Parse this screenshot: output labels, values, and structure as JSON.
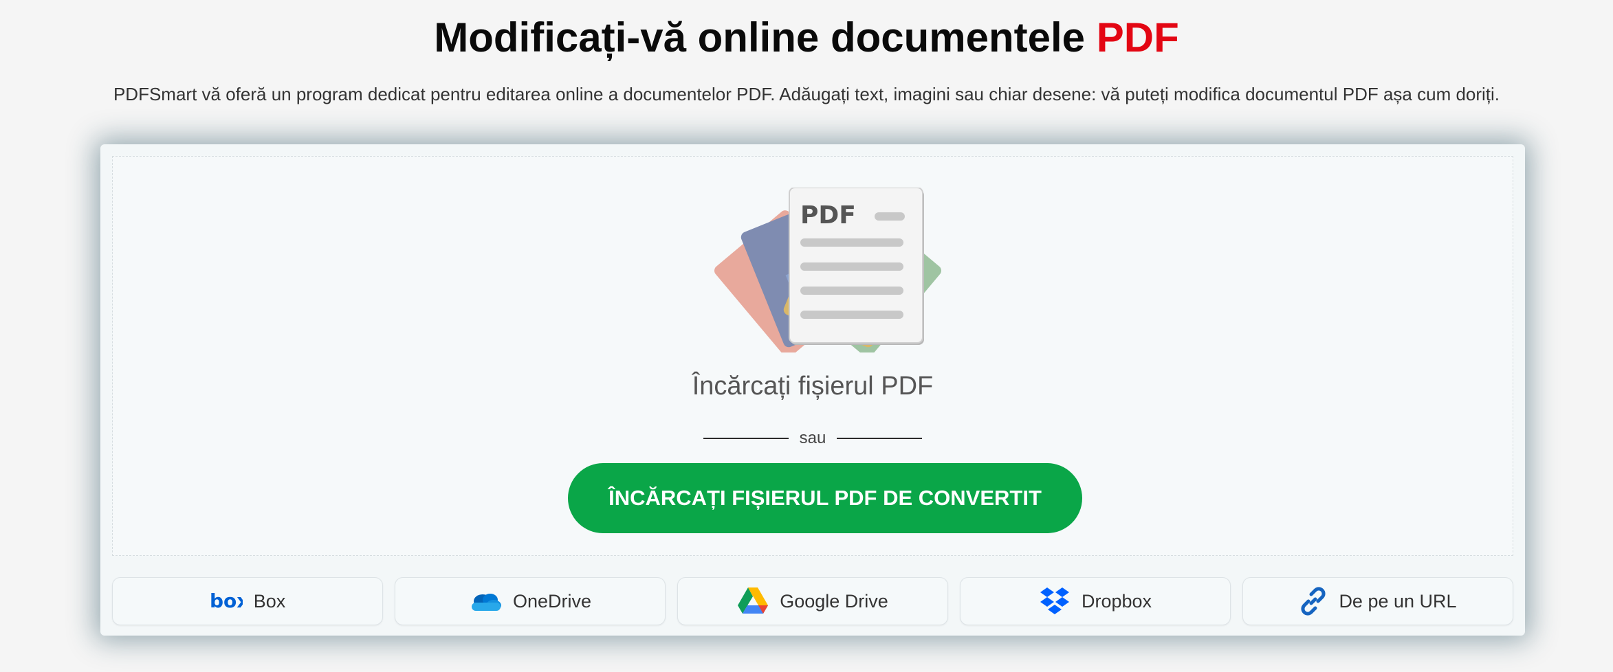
{
  "header": {
    "title_main": "Modificați-vă online documentele",
    "title_accent": "PDF",
    "subtitle": "PDFSmart vă oferă un program dedicat pentru editarea online a documentelor PDF. Adăugați text, imagini sau chiar desene: vă puteți modifica documentul PDF așa cum doriți."
  },
  "dropzone": {
    "illustration_icon": "pdf-document-stack-icon",
    "doc_label": "PDF",
    "upload_label": "Încărcați fișierul PDF",
    "or_text": "sau",
    "upload_button": "ÎNCĂRCAȚI FIȘIERUL PDF DE CONVERTIT"
  },
  "sources": [
    {
      "label": "Box",
      "icon": "box-logo-icon"
    },
    {
      "label": "OneDrive",
      "icon": "onedrive-icon"
    },
    {
      "label": "Google Drive",
      "icon": "google-drive-icon"
    },
    {
      "label": "Dropbox",
      "icon": "dropbox-icon"
    },
    {
      "label": "De pe un URL",
      "icon": "link-icon"
    }
  ],
  "colors": {
    "accent_red": "#e30613",
    "button_green": "#0aa648",
    "page_bg": "#f5f5f5",
    "card_bg": "#f3f7f8"
  }
}
